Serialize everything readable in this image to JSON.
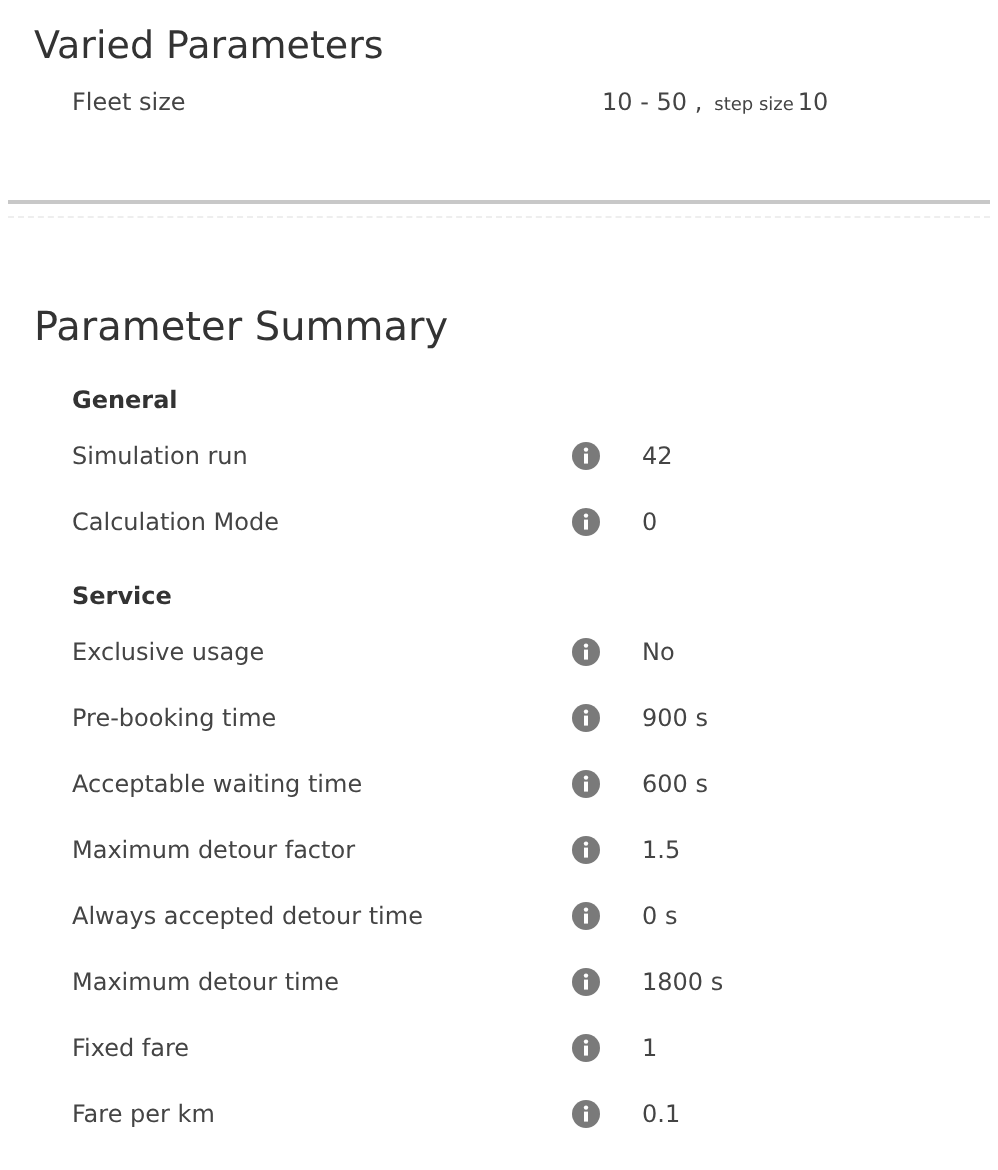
{
  "varied": {
    "title": "Varied Parameters",
    "rows": [
      {
        "label": "Fleet size",
        "range": "10 - 50 ,",
        "step_label": "step size",
        "step": "10"
      }
    ]
  },
  "summary": {
    "title": "Parameter Summary",
    "groups": [
      {
        "title": "General",
        "rows": [
          {
            "label": "Simulation run",
            "value": "42"
          },
          {
            "label": "Calculation Mode",
            "value": "0"
          }
        ]
      },
      {
        "title": "Service",
        "rows": [
          {
            "label": "Exclusive usage",
            "value": "No"
          },
          {
            "label": "Pre-booking time",
            "value": "900 s"
          },
          {
            "label": "Acceptable waiting time",
            "value": "600 s"
          },
          {
            "label": "Maximum detour factor",
            "value": "1.5"
          },
          {
            "label": "Always accepted detour time",
            "value": "0 s"
          },
          {
            "label": "Maximum detour time",
            "value": "1800 s"
          },
          {
            "label": "Fixed fare",
            "value": "1"
          },
          {
            "label": "Fare per km",
            "value": "0.1"
          }
        ]
      }
    ]
  }
}
